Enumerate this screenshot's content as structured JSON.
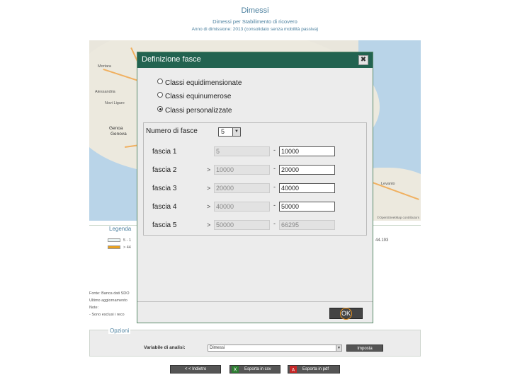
{
  "header": {
    "title": "Dimessi",
    "subtitle": "Dimessi per Stabilimento di ricovero",
    "subtitle2": "Anno di dimissione: 2013 (consolidato senza mobilità passiva)"
  },
  "map": {
    "labels": [
      "Mortara",
      "Novi Ligure",
      "Alessandria",
      "Genoa",
      "Genova",
      "Levanto"
    ],
    "copyright": "©OpenStreetMap contributors"
  },
  "legend": {
    "title": "Legenda",
    "rows": [
      {
        "text": "5 - 1",
        "color": "#e8f4f4"
      },
      {
        "text": "> 44",
        "color": "#e8a020"
      }
    ],
    "value": "44.193"
  },
  "notes": [
    "Fonte: Banca dati SDO",
    "Ultimo aggiornamento",
    "Note:",
    " - Sono esclusi i reco"
  ],
  "options": {
    "title": "Opzioni",
    "variable_label": "Variabile di analisi:",
    "variable_value": "Dimessi",
    "apply_label": "Imposta"
  },
  "bottom_buttons": {
    "back": "< < Indietro",
    "csv": "Esporta in csv",
    "pdf": "Esporta in pdf"
  },
  "dialog": {
    "title": "Definizione fasce",
    "close": "✖",
    "radio_options": [
      {
        "label": "Classi equidimensionate",
        "checked": false
      },
      {
        "label": "Classi equinumerose",
        "checked": false
      },
      {
        "label": "Classi personalizzate",
        "checked": true
      }
    ],
    "num_fasce_label": "Numero di fasce",
    "num_fasce_value": "5",
    "fasce": [
      {
        "label": "fascia 1",
        "gt": "",
        "from": "5",
        "to": "10000"
      },
      {
        "label": "fascia 2",
        "gt": ">",
        "from": "10000",
        "to": "20000"
      },
      {
        "label": "fascia 3",
        "gt": ">",
        "from": "20000",
        "to": "40000"
      },
      {
        "label": "fascia 4",
        "gt": ">",
        "from": "40000",
        "to": "50000"
      },
      {
        "label": "fascia 5",
        "gt": ">",
        "from": "50000",
        "to": "66295"
      }
    ],
    "ok_label": "OK"
  }
}
